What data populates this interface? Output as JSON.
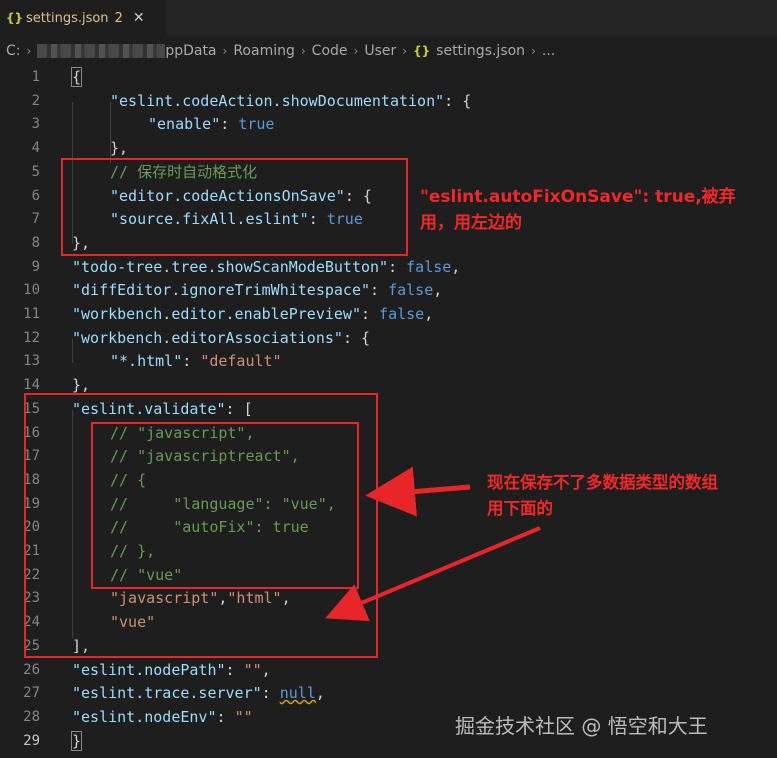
{
  "tab": {
    "icon": "braces-icon",
    "braces": "{}",
    "filename": "settings.json",
    "problems": "2",
    "close": "✕"
  },
  "breadcrumb": {
    "drive": "C:",
    "parts": [
      "ppData",
      "Roaming",
      "Code",
      "User"
    ],
    "file_braces": "{}",
    "file": "settings.json",
    "ellipsis": "..."
  },
  "lines": [
    {
      "n": "1",
      "code": "{"
    },
    {
      "n": "2",
      "code": "\"eslint.codeAction.showDocumentation\": {"
    },
    {
      "n": "3",
      "code": "\"enable\": true"
    },
    {
      "n": "4",
      "code": "},"
    },
    {
      "n": "5",
      "code": "// 保存时自动格式化"
    },
    {
      "n": "6",
      "code": "\"editor.codeActionsOnSave\": {"
    },
    {
      "n": "7",
      "code": "\"source.fixAll.eslint\": true"
    },
    {
      "n": "8",
      "code": "},"
    },
    {
      "n": "9",
      "code": "\"todo-tree.tree.showScanModeButton\": false,"
    },
    {
      "n": "10",
      "code": "\"diffEditor.ignoreTrimWhitespace\": false,"
    },
    {
      "n": "11",
      "code": "\"workbench.editor.enablePreview\": false,"
    },
    {
      "n": "12",
      "code": "\"workbench.editorAssociations\": {"
    },
    {
      "n": "13",
      "code": "\"*.html\": \"default\""
    },
    {
      "n": "14",
      "code": "},"
    },
    {
      "n": "15",
      "code": "\"eslint.validate\": ["
    },
    {
      "n": "16",
      "code": "// \"javascript\","
    },
    {
      "n": "17",
      "code": "// \"javascriptreact\","
    },
    {
      "n": "18",
      "code": "// {"
    },
    {
      "n": "19",
      "code": "//     \"language\": \"vue\","
    },
    {
      "n": "20",
      "code": "//     \"autoFix\": true"
    },
    {
      "n": "21",
      "code": "// },"
    },
    {
      "n": "22",
      "code": "// \"vue\""
    },
    {
      "n": "23",
      "code": "\"javascript\",\"html\","
    },
    {
      "n": "24",
      "code": "\"vue\""
    },
    {
      "n": "25",
      "code": "],"
    },
    {
      "n": "26",
      "code": "\"eslint.nodePath\": \"\","
    },
    {
      "n": "27",
      "code": "\"eslint.trace.server\": null,"
    },
    {
      "n": "28",
      "code": "\"eslint.nodeEnv\": \"\""
    },
    {
      "n": "29",
      "code": "}"
    }
  ],
  "annotations": {
    "note1_line1": "\"eslint.autoFixOnSave\": true,被弃",
    "note1_line2": "用，用左边的",
    "note2_line1": "现在保存不了多数据类型的数组",
    "note2_line2": "用下面的",
    "color": "#e8262a"
  },
  "watermark": "掘金技术社区 @ 悟空和大王"
}
